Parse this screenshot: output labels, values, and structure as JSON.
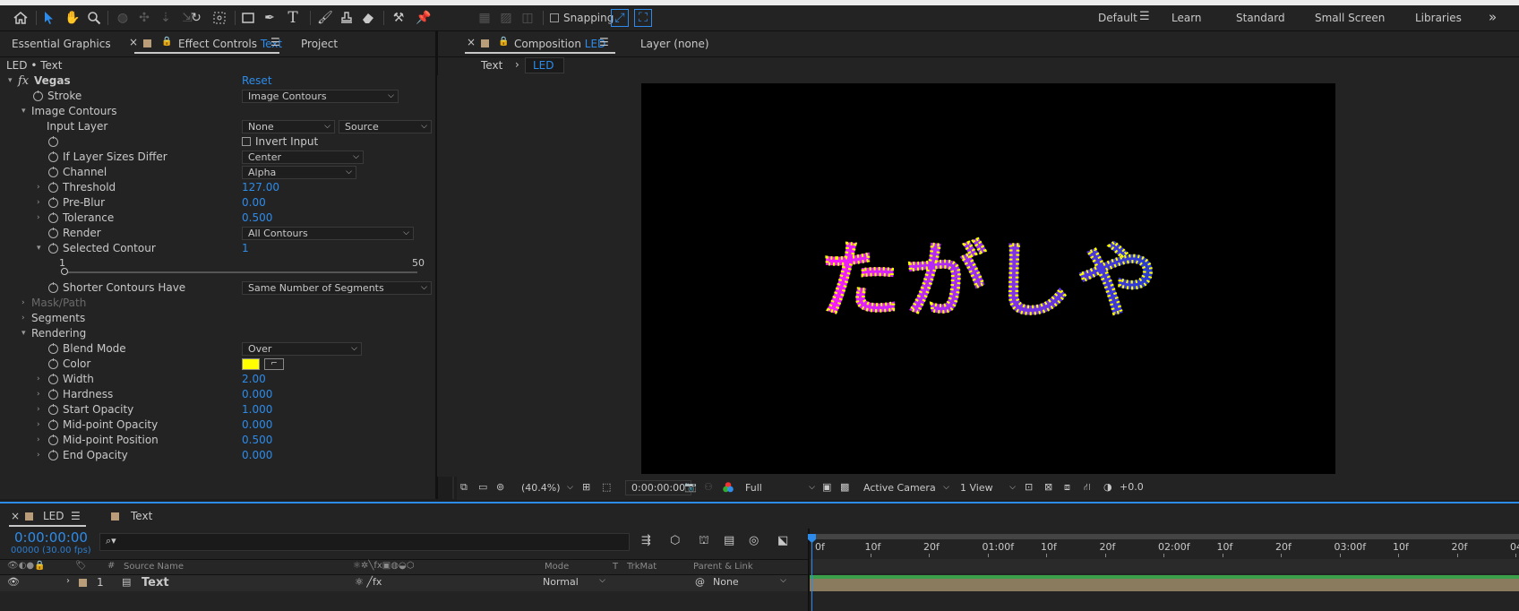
{
  "toolbar": {
    "snapping_label": "Snapping",
    "workspaces": [
      "Default",
      "Learn",
      "Standard",
      "Small Screen",
      "Libraries"
    ],
    "active_workspace": "Default",
    "more": "»"
  },
  "left_panel": {
    "tabs": {
      "essential": "Essential Graphics",
      "effect_prefix": "Effect Controls",
      "effect_layer": "Text",
      "project": "Project"
    },
    "breadcrumb": "LED • Text",
    "effect": {
      "fx": "fx",
      "name": "Vegas",
      "reset": "Reset"
    },
    "rows": {
      "stroke": {
        "label": "Stroke",
        "value": "Image Contours"
      },
      "image_contours": "Image Contours",
      "input_layer": {
        "label": "Input Layer",
        "value1": "None",
        "value2": "Source"
      },
      "invert_input": "Invert Input",
      "layer_sizes": {
        "label": "If Layer Sizes Differ",
        "value": "Center"
      },
      "channel": {
        "label": "Channel",
        "value": "Alpha"
      },
      "threshold": {
        "label": "Threshold",
        "value": "127.00"
      },
      "preblur": {
        "label": "Pre-Blur",
        "value": "0.00"
      },
      "tolerance": {
        "label": "Tolerance",
        "value": "0.500"
      },
      "render": {
        "label": "Render",
        "value": "All Contours"
      },
      "selected_contour": {
        "label": "Selected Contour",
        "value": "1",
        "slider_min": "1",
        "slider_max": "50",
        "slider_fraction": 0
      },
      "shorter": {
        "label": "Shorter Contours Have",
        "value": "Same Number of Segments"
      },
      "mask_path": "Mask/Path",
      "segments": "Segments",
      "rendering": "Rendering",
      "blend_mode": {
        "label": "Blend Mode",
        "value": "Over"
      },
      "color": {
        "label": "Color",
        "swatch": "#ffff00"
      },
      "width": {
        "label": "Width",
        "value": "2.00"
      },
      "hardness": {
        "label": "Hardness",
        "value": "0.000"
      },
      "start_opacity": {
        "label": "Start Opacity",
        "value": "1.000"
      },
      "mid_opacity": {
        "label": "Mid-point Opacity",
        "value": "0.000"
      },
      "mid_position": {
        "label": "Mid-point Position",
        "value": "0.500"
      },
      "end_opacity": {
        "label": "End Opacity",
        "value": "0.000"
      }
    }
  },
  "comp_panel": {
    "tab_prefix": "Composition",
    "tab_name": "LED",
    "layer_tab": "Layer  (none)",
    "crumbs": [
      "Text",
      "LED"
    ],
    "canvas_text": "たがしや",
    "gradient": [
      "#ff1aff",
      "#9b2ff0",
      "#1f3ccf"
    ]
  },
  "viewer_bar": {
    "zoom": "(40.4%)",
    "timecode": "0:00:00:00",
    "resolution": "Full",
    "camera": "Active Camera",
    "views": "1 View",
    "exposure": "+0.0"
  },
  "timeline": {
    "tabs": [
      "LED",
      "Text"
    ],
    "timecode": "0:00:00:00",
    "frames": "00000 (30.00 fps)",
    "search_placeholder": "",
    "headers": {
      "source_name": "Source Name",
      "mode": "Mode",
      "t": "T",
      "trkmat": "TrkMat",
      "parent": "Parent & Link"
    },
    "layer": {
      "number": "1",
      "name": "Text",
      "mode": "Normal",
      "parent": "None"
    },
    "ruler": [
      "0f",
      "10f",
      "20f",
      "01:00f",
      "10f",
      "20f",
      "02:00f",
      "10f",
      "20f",
      "03:00f",
      "10f",
      "20f",
      "04:"
    ]
  }
}
